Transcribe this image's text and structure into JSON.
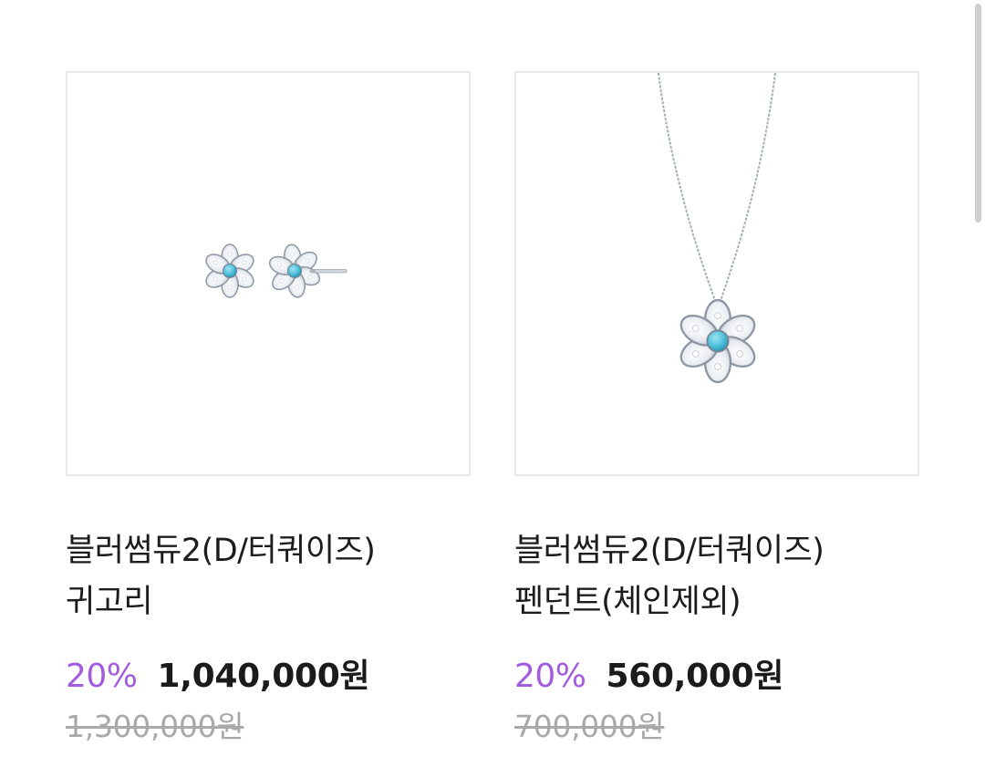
{
  "products": [
    {
      "name_line1": "블러썸듀2(D/터쿼이즈)",
      "name_line2": "귀고리",
      "discount": "20%",
      "sale_price": "1,040,000원",
      "original_price": "1,300,000원",
      "image_icon": "flower-earrings-image"
    },
    {
      "name_line1": "블러썸듀2(D/터쿼이즈)",
      "name_line2": "펜던트(체인제외)",
      "discount": "20%",
      "sale_price": "560,000원",
      "original_price": "700,000원",
      "image_icon": "flower-pendant-necklace-image"
    }
  ],
  "colors": {
    "discount": "#a35be0",
    "sale_price": "#1b1b1b",
    "original_price": "#a9a9a9",
    "border": "#e9e9eb",
    "turquoise": "#4fc1dd"
  }
}
